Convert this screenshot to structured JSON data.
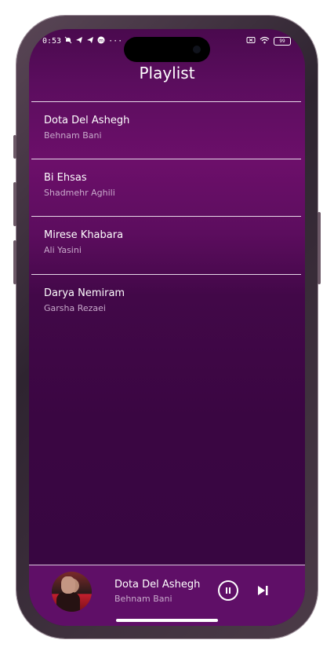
{
  "status_bar": {
    "time": "0:53",
    "left_icons": [
      "notifications-off-icon",
      "telegram-icon",
      "telegram-icon",
      "app-icon"
    ],
    "more": "···",
    "right_icons": [
      "screen-record-icon",
      "wifi-icon"
    ],
    "battery": "99"
  },
  "title": "Playlist",
  "playlist": [
    {
      "title": "Dota Del Ashegh",
      "artist": "Behnam Bani"
    },
    {
      "title": "Bi Ehsas",
      "artist": "Shadmehr Aghili"
    },
    {
      "title": "Mirese Khabara",
      "artist": "Ali Yasini"
    },
    {
      "title": "Darya Nemiram",
      "artist": "Garsha Rezaei"
    }
  ],
  "player": {
    "title": "Dota Del Ashegh",
    "artist": "Behnam Bani",
    "album_art": "album-art-image",
    "controls": [
      "pause-icon",
      "skip-next-icon"
    ]
  },
  "colors": {
    "background_top": "#4a0a4e",
    "background_mid": "#6c0f6a",
    "background_bottom": "#380641",
    "player_bar": "#5f0f67",
    "divider": "#e6d8e8",
    "primary_text": "#ffffff",
    "secondary_text": "#c8a9cb"
  }
}
